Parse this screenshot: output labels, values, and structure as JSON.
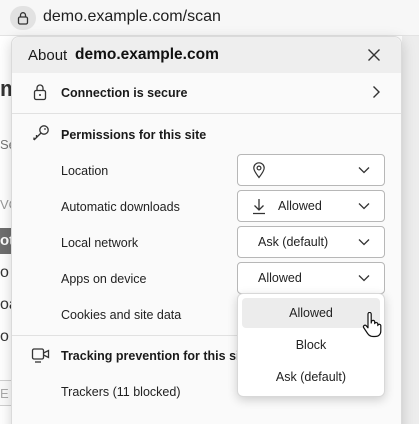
{
  "address_bar": {
    "url": "demo.example.com/scan",
    "lock_icon": "lock-icon"
  },
  "background_page": {
    "fragments": [
      "m",
      "Se",
      "VC",
      "ot",
      "o",
      "oa",
      "o",
      "E"
    ]
  },
  "popup": {
    "about_label": "About",
    "domain": "demo.example.com",
    "close_icon": "close-icon",
    "connection": {
      "label": "Connection is secure",
      "icon": "lock-icon"
    },
    "permissions": {
      "title": "Permissions for this site",
      "icon": "key-icon",
      "items": [
        {
          "label": "Location",
          "value": "",
          "icon": "location-pin-icon"
        },
        {
          "label": "Automatic downloads",
          "value": "Allowed",
          "icon": "download-icon"
        },
        {
          "label": "Local network",
          "value": "Ask (default)"
        },
        {
          "label": "Apps on device",
          "value": "Allowed"
        },
        {
          "label": "Cookies and site data"
        }
      ]
    },
    "tracking": {
      "title": "Tracking prevention for this site",
      "icon": "camera-icon",
      "trackers": "Trackers (11 blocked)"
    }
  },
  "dropdown": {
    "options": [
      "Allowed",
      "Block",
      "Ask (default)"
    ],
    "highlighted": "Allowed"
  },
  "colors": {
    "header_bg": "#eeeeee",
    "popup_bg": "#fafafa",
    "option_hover": "#ececec"
  }
}
